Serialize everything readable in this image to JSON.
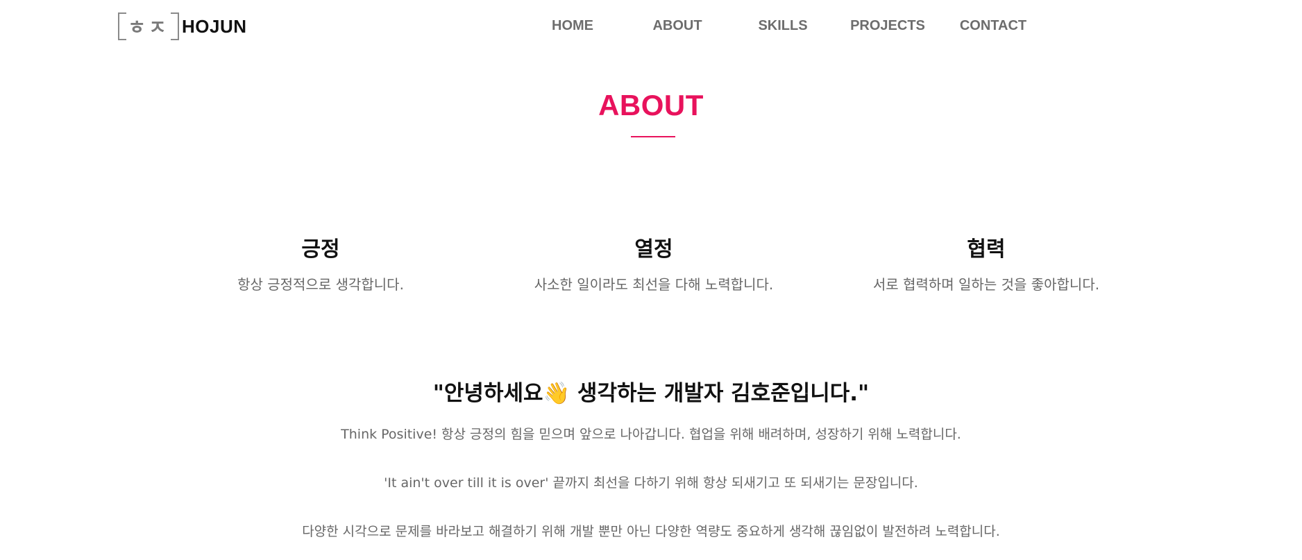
{
  "header": {
    "logo": {
      "mark_glyphs": "ㅎㅈ",
      "name": "HOJUN"
    },
    "nav": [
      {
        "label": "HOME"
      },
      {
        "label": "ABOUT"
      },
      {
        "label": "SKILLS"
      },
      {
        "label": "PROJECTS"
      },
      {
        "label": "CONTACT"
      }
    ]
  },
  "about": {
    "title": "ABOUT",
    "accent_color": "#e8125c",
    "values": [
      {
        "title": "긍정",
        "description": "항상 긍정적으로 생각합니다."
      },
      {
        "title": "열정",
        "description": "사소한 일이라도 최선을 다해 노력합니다."
      },
      {
        "title": "협력",
        "description": "서로 협력하며 일하는 것을 좋아합니다."
      }
    ],
    "intro": {
      "heading_before": "\"안녕하세요",
      "heading_emoji": "👋",
      "heading_after": " 생각하는 개발자 김호준입니다.\"",
      "paragraphs": [
        "Think Positive! 항상 긍정의 힘을 믿으며 앞으로 나아갑니다. 협업을 위해 배려하며, 성장하기 위해 노력합니다.",
        "'It ain't over till it is over' 끝까지 최선을 다하기 위해 항상 되새기고 또 되새기는 문장입니다.",
        "다양한 시각으로 문제를 바라보고 해결하기 위해 개발 뿐만 아닌 다양한 역량도 중요하게 생각해 끊임없이 발전하려 노력합니다."
      ]
    }
  }
}
